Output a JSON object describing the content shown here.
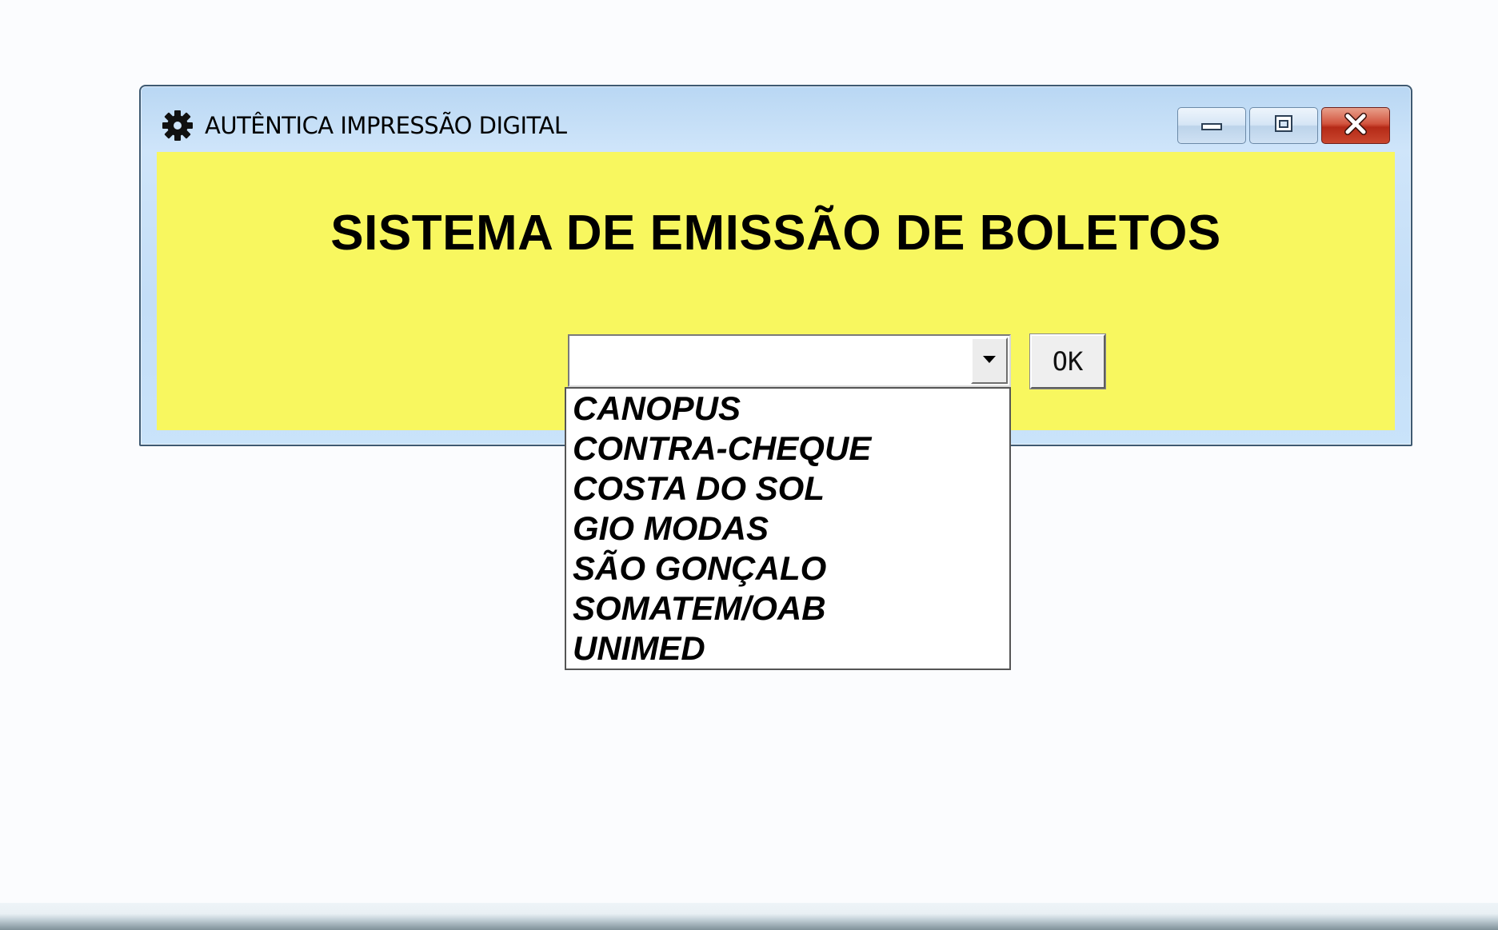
{
  "window": {
    "title": "AUTÊNTICA IMPRESSÃO DIGITAL",
    "app_icon": "gear-icon",
    "caption_buttons": {
      "minimize_icon": "minimize-icon",
      "maximize_icon": "maximize-icon",
      "close_icon": "close-icon"
    },
    "background_color": "#f8f75f"
  },
  "main": {
    "heading": "SISTEMA DE EMISSÃO DE BOLETOS",
    "combo": {
      "selected_value": "",
      "expanded": true
    },
    "ok_label": "OK"
  },
  "dropdown": {
    "options": [
      "CANOPUS",
      "CONTRA-CHEQUE",
      "COSTA DO SOL",
      "GIO MODAS",
      "SÃO GONÇALO",
      "SOMATEM/OAB",
      "UNIMED"
    ]
  }
}
